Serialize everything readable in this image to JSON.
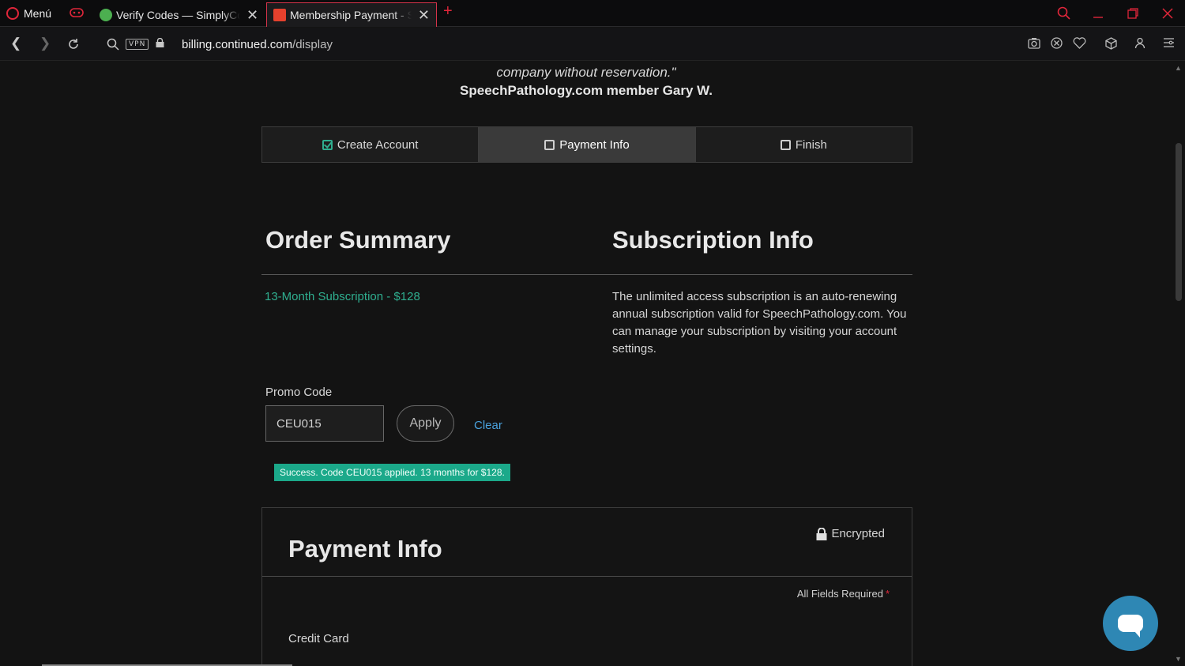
{
  "browser": {
    "menu_label": "Menú",
    "tabs": [
      {
        "title": "Verify Codes — SimplyCodes",
        "active": false
      },
      {
        "title": "Membership Payment - SpeechPathology.com",
        "active": true
      }
    ],
    "new_tab": "+",
    "url": {
      "domain": "billing.continued.com",
      "path": "/display"
    },
    "vpn_label": "VPN",
    "accent_color": "#e0263a"
  },
  "testimonial": {
    "quote_tail": "company without reservation.\"",
    "author": "SpeechPathology.com member Gary W."
  },
  "steps": [
    {
      "label": "Create Account",
      "state": "done"
    },
    {
      "label": "Payment Info",
      "state": "active"
    },
    {
      "label": "Finish",
      "state": "pending"
    }
  ],
  "order_summary": {
    "heading": "Order Summary",
    "line": "13-Month Subscription - $128"
  },
  "subscription_info": {
    "heading": "Subscription Info",
    "text": "The unlimited access subscription is an auto-renewing annual subscription valid for SpeechPathology.com. You can manage your subscription by visiting your account settings."
  },
  "promo": {
    "label": "Promo Code",
    "value": "CEU015",
    "apply_label": "Apply",
    "clear_label": "Clear",
    "success_message": "Success. Code CEU015 applied. 13 months for $128."
  },
  "payment": {
    "heading": "Payment Info",
    "encrypted_label": "Encrypted",
    "required_note": "All Fields Required",
    "required_star": "*",
    "credit_card_label": "Credit Card"
  },
  "colors": {
    "success": "#1ba98a",
    "link": "#4aa3df",
    "chat": "#2e87b4"
  }
}
